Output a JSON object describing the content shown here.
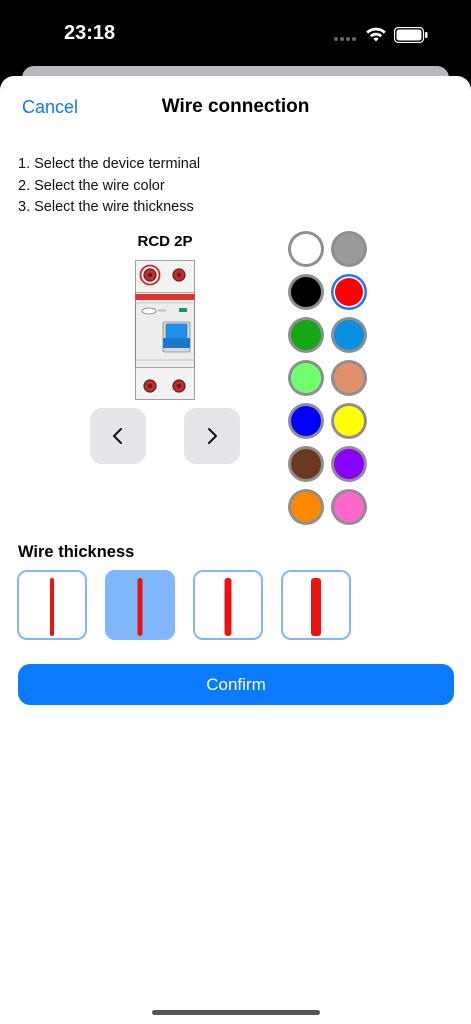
{
  "status_bar": {
    "time": "23:18"
  },
  "nav": {
    "cancel_label": "Cancel",
    "title": "Wire connection"
  },
  "instructions": [
    "1. Select the device terminal",
    "2. Select the wire color",
    "3. Select the wire thickness"
  ],
  "device": {
    "title": "RCD 2P",
    "body_color": "#f0f0f0",
    "stripe_color": "#e03030",
    "terminal_color": "#e02020",
    "handle_color": "#1f8ee8"
  },
  "colors": {
    "accent": "#0a7aff",
    "selected_ring": "#1a75ff",
    "palette": [
      "#ffffff",
      "#9a9a9a",
      "#000000",
      "#ff0000",
      "#13a813",
      "#0a90e0",
      "#6fff6f",
      "#e0906a",
      "#0000ff",
      "#ffff00",
      "#6b3a1e",
      "#8800ff",
      "#ff8800",
      "#ff66cc"
    ],
    "selected_index": 3
  },
  "thickness": {
    "title": "Wire thickness",
    "options_count": 4,
    "selected_index": 1
  },
  "confirm_label": "Confirm"
}
